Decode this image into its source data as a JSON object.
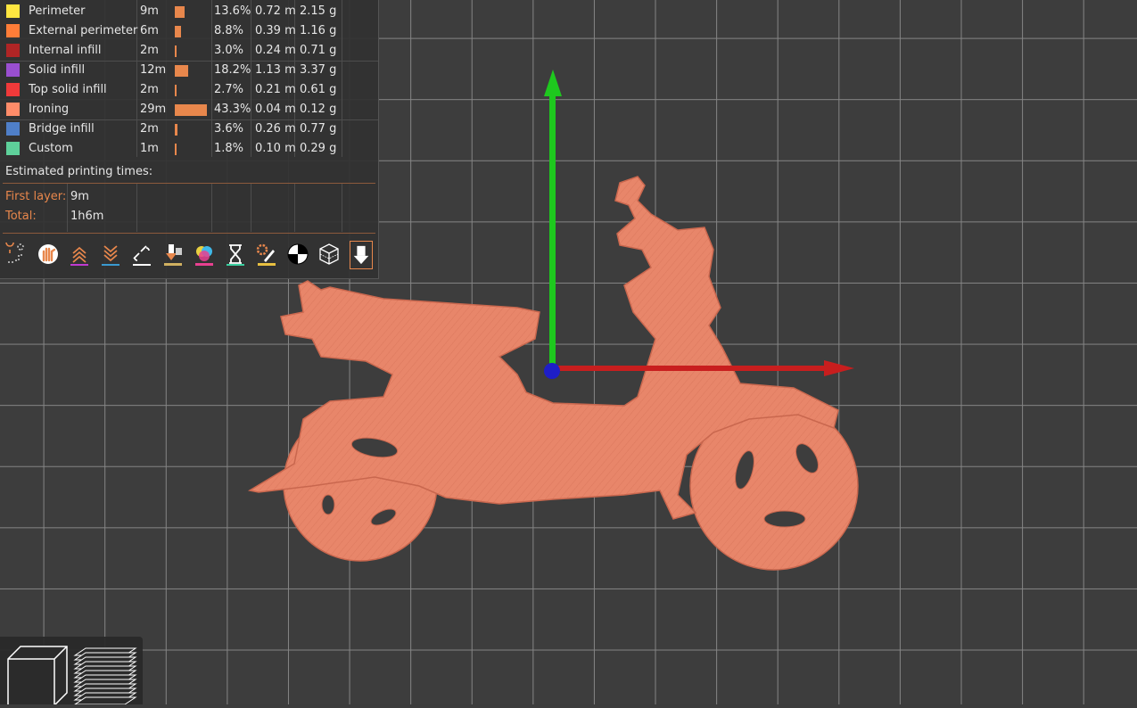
{
  "legend": {
    "features": [
      {
        "name": "Perimeter",
        "time": "9m",
        "percent": "13.6%",
        "length": "0.72 m",
        "weight": "2.15 g",
        "color": "#ffe640",
        "share": 0.136
      },
      {
        "name": "External perimeter",
        "time": "6m",
        "percent": "8.8%",
        "length": "0.39 m",
        "weight": "1.16 g",
        "color": "#ff7d38",
        "share": 0.088
      },
      {
        "name": "Internal infill",
        "time": "2m",
        "percent": "3.0%",
        "length": "0.24 m",
        "weight": "0.71 g",
        "color": "#b02525",
        "share": 0.03
      },
      {
        "name": "Solid infill",
        "time": "12m",
        "percent": "18.2%",
        "length": "1.13 m",
        "weight": "3.37 g",
        "color": "#9a4fd0",
        "share": 0.182
      },
      {
        "name": "Top solid infill",
        "time": "2m",
        "percent": "2.7%",
        "length": "0.21 m",
        "weight": "0.61 g",
        "color": "#f03a3a",
        "share": 0.027
      },
      {
        "name": "Ironing",
        "time": "29m",
        "percent": "43.3%",
        "length": "0.04 m",
        "weight": "0.12 g",
        "color": "#ff8c69",
        "share": 0.433
      },
      {
        "name": "Bridge infill",
        "time": "2m",
        "percent": "3.6%",
        "length": "0.26 m",
        "weight": "0.77 g",
        "color": "#4f7fc8",
        "share": 0.036
      },
      {
        "name": "Custom",
        "time": "1m",
        "percent": "1.8%",
        "length": "0.10 m",
        "weight": "0.29 g",
        "color": "#5ed09a",
        "share": 0.018
      }
    ],
    "estimated_title": "Estimated printing times:",
    "first_layer_label": "First layer:",
    "first_layer_value": "9m",
    "total_label": "Total:",
    "total_value": "1h6m"
  },
  "toolbar": {
    "icons": [
      "travel-icon",
      "retractions-icon",
      "deretractions-icon",
      "wipes-icon",
      "seams-icon",
      "tool-changes-icon",
      "color-changes-icon",
      "pause-icon",
      "custom-gcode-icon",
      "center-of-gravity-icon",
      "shells-icon",
      "tool-marker-icon"
    ]
  },
  "colors": {
    "accent": "#e8874c",
    "model": "#e8866a",
    "x_axis": "#c81e1e",
    "y_axis": "#1ec81e",
    "z_axis": "#1e1ec8"
  }
}
